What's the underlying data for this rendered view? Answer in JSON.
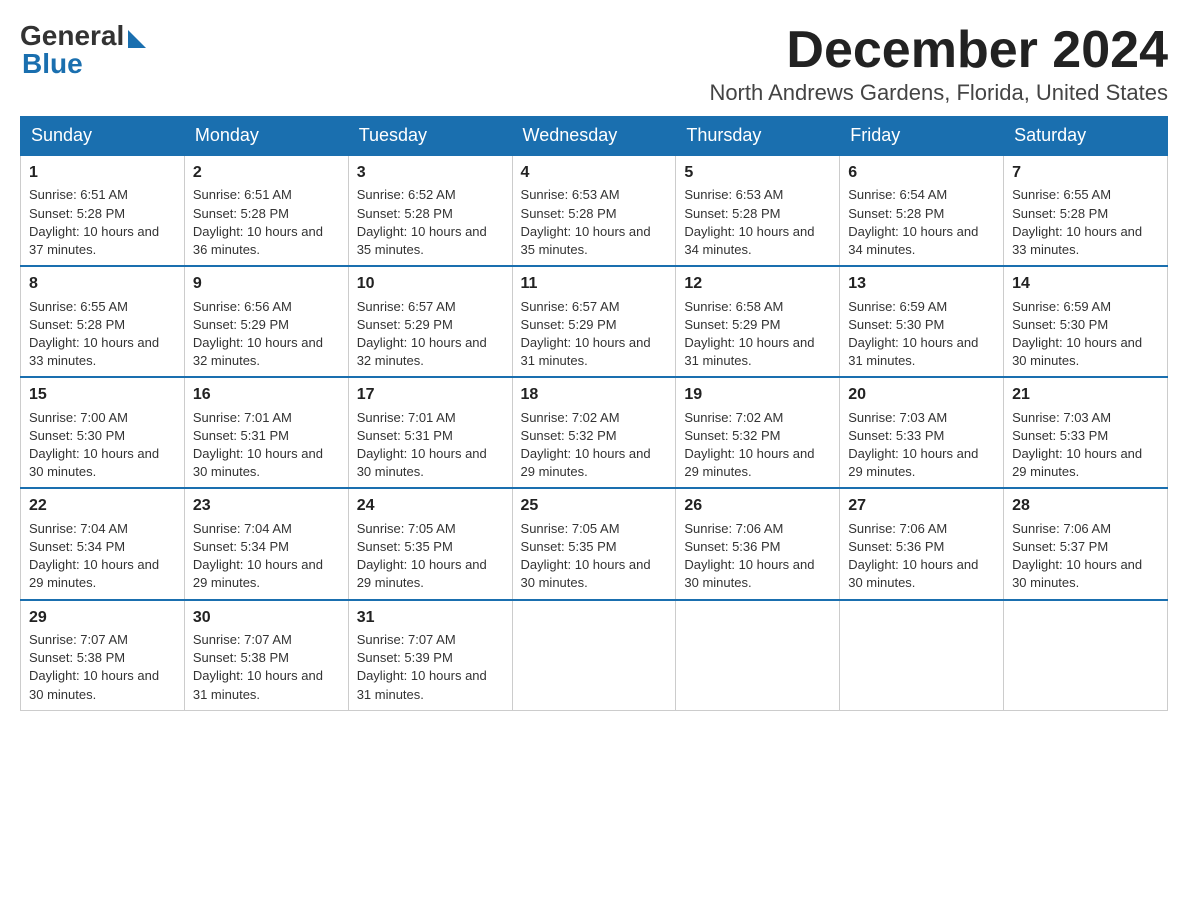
{
  "logo": {
    "general_text": "General",
    "blue_text": "Blue"
  },
  "header": {
    "month_year": "December 2024",
    "location": "North Andrews Gardens, Florida, United States"
  },
  "weekdays": [
    "Sunday",
    "Monday",
    "Tuesday",
    "Wednesday",
    "Thursday",
    "Friday",
    "Saturday"
  ],
  "weeks": [
    [
      {
        "day": "1",
        "sunrise": "6:51 AM",
        "sunset": "5:28 PM",
        "daylight": "10 hours and 37 minutes."
      },
      {
        "day": "2",
        "sunrise": "6:51 AM",
        "sunset": "5:28 PM",
        "daylight": "10 hours and 36 minutes."
      },
      {
        "day": "3",
        "sunrise": "6:52 AM",
        "sunset": "5:28 PM",
        "daylight": "10 hours and 35 minutes."
      },
      {
        "day": "4",
        "sunrise": "6:53 AM",
        "sunset": "5:28 PM",
        "daylight": "10 hours and 35 minutes."
      },
      {
        "day": "5",
        "sunrise": "6:53 AM",
        "sunset": "5:28 PM",
        "daylight": "10 hours and 34 minutes."
      },
      {
        "day": "6",
        "sunrise": "6:54 AM",
        "sunset": "5:28 PM",
        "daylight": "10 hours and 34 minutes."
      },
      {
        "day": "7",
        "sunrise": "6:55 AM",
        "sunset": "5:28 PM",
        "daylight": "10 hours and 33 minutes."
      }
    ],
    [
      {
        "day": "8",
        "sunrise": "6:55 AM",
        "sunset": "5:28 PM",
        "daylight": "10 hours and 33 minutes."
      },
      {
        "day": "9",
        "sunrise": "6:56 AM",
        "sunset": "5:29 PM",
        "daylight": "10 hours and 32 minutes."
      },
      {
        "day": "10",
        "sunrise": "6:57 AM",
        "sunset": "5:29 PM",
        "daylight": "10 hours and 32 minutes."
      },
      {
        "day": "11",
        "sunrise": "6:57 AM",
        "sunset": "5:29 PM",
        "daylight": "10 hours and 31 minutes."
      },
      {
        "day": "12",
        "sunrise": "6:58 AM",
        "sunset": "5:29 PM",
        "daylight": "10 hours and 31 minutes."
      },
      {
        "day": "13",
        "sunrise": "6:59 AM",
        "sunset": "5:30 PM",
        "daylight": "10 hours and 31 minutes."
      },
      {
        "day": "14",
        "sunrise": "6:59 AM",
        "sunset": "5:30 PM",
        "daylight": "10 hours and 30 minutes."
      }
    ],
    [
      {
        "day": "15",
        "sunrise": "7:00 AM",
        "sunset": "5:30 PM",
        "daylight": "10 hours and 30 minutes."
      },
      {
        "day": "16",
        "sunrise": "7:01 AM",
        "sunset": "5:31 PM",
        "daylight": "10 hours and 30 minutes."
      },
      {
        "day": "17",
        "sunrise": "7:01 AM",
        "sunset": "5:31 PM",
        "daylight": "10 hours and 30 minutes."
      },
      {
        "day": "18",
        "sunrise": "7:02 AM",
        "sunset": "5:32 PM",
        "daylight": "10 hours and 29 minutes."
      },
      {
        "day": "19",
        "sunrise": "7:02 AM",
        "sunset": "5:32 PM",
        "daylight": "10 hours and 29 minutes."
      },
      {
        "day": "20",
        "sunrise": "7:03 AM",
        "sunset": "5:33 PM",
        "daylight": "10 hours and 29 minutes."
      },
      {
        "day": "21",
        "sunrise": "7:03 AM",
        "sunset": "5:33 PM",
        "daylight": "10 hours and 29 minutes."
      }
    ],
    [
      {
        "day": "22",
        "sunrise": "7:04 AM",
        "sunset": "5:34 PM",
        "daylight": "10 hours and 29 minutes."
      },
      {
        "day": "23",
        "sunrise": "7:04 AM",
        "sunset": "5:34 PM",
        "daylight": "10 hours and 29 minutes."
      },
      {
        "day": "24",
        "sunrise": "7:05 AM",
        "sunset": "5:35 PM",
        "daylight": "10 hours and 29 minutes."
      },
      {
        "day": "25",
        "sunrise": "7:05 AM",
        "sunset": "5:35 PM",
        "daylight": "10 hours and 30 minutes."
      },
      {
        "day": "26",
        "sunrise": "7:06 AM",
        "sunset": "5:36 PM",
        "daylight": "10 hours and 30 minutes."
      },
      {
        "day": "27",
        "sunrise": "7:06 AM",
        "sunset": "5:36 PM",
        "daylight": "10 hours and 30 minutes."
      },
      {
        "day": "28",
        "sunrise": "7:06 AM",
        "sunset": "5:37 PM",
        "daylight": "10 hours and 30 minutes."
      }
    ],
    [
      {
        "day": "29",
        "sunrise": "7:07 AM",
        "sunset": "5:38 PM",
        "daylight": "10 hours and 30 minutes."
      },
      {
        "day": "30",
        "sunrise": "7:07 AM",
        "sunset": "5:38 PM",
        "daylight": "10 hours and 31 minutes."
      },
      {
        "day": "31",
        "sunrise": "7:07 AM",
        "sunset": "5:39 PM",
        "daylight": "10 hours and 31 minutes."
      },
      null,
      null,
      null,
      null
    ]
  ],
  "colors": {
    "header_bg": "#1a6faf",
    "border": "#1a6faf",
    "cell_border": "#cccccc",
    "text_dark": "#222222",
    "logo_blue": "#1a6faf"
  }
}
